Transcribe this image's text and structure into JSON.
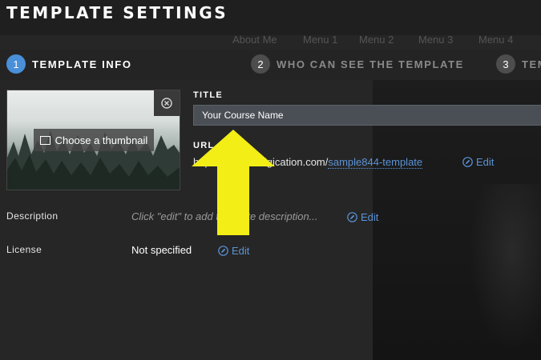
{
  "header": {
    "title": "TEMPLATE SETTINGS"
  },
  "background_nav": [
    "About Me",
    "Menu 1",
    "Menu 2",
    "Menu 3",
    "Menu 4"
  ],
  "steps": [
    {
      "num": "1",
      "label": "TEMPLATE INFO",
      "active": true
    },
    {
      "num": "2",
      "label": "WHO CAN SEE THE TEMPLATE",
      "active": false
    },
    {
      "num": "3",
      "label": "TEM",
      "active": false
    }
  ],
  "thumbnail": {
    "button_label": "Choose a thumbnail"
  },
  "title_field": {
    "label": "TITLE",
    "value": "Your Course Name"
  },
  "url_field": {
    "label": "URL",
    "prefix": "https://...state.digication.com/",
    "slug": "sample844-template",
    "edit_label": "Edit"
  },
  "description": {
    "label": "Description",
    "placeholder": "Click \"edit\" to add template description...",
    "edit_label": "Edit"
  },
  "license": {
    "label": "License",
    "value": "Not specified",
    "edit_label": "Edit"
  },
  "colors": {
    "accent": "#4a8fd9",
    "link": "#5b93d6",
    "arrow": "#f2ee16",
    "background": "#262626"
  }
}
